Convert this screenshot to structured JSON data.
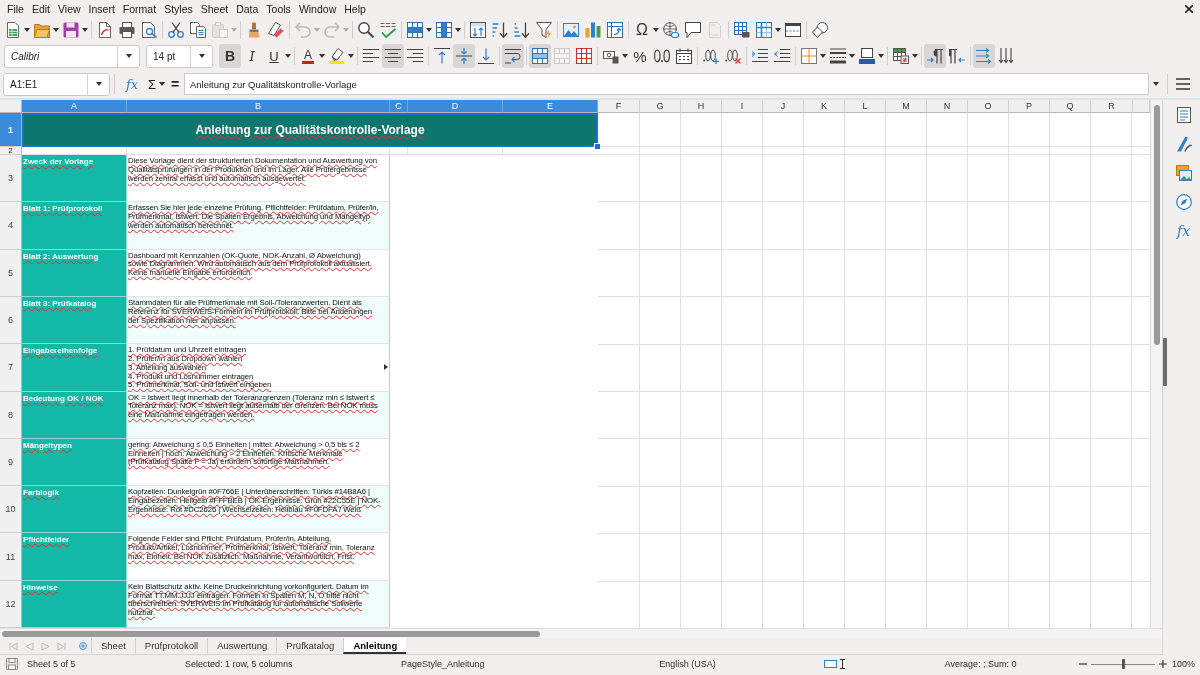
{
  "menu_bar": {
    "items": [
      "File",
      "Edit",
      "View",
      "Insert",
      "Format",
      "Styles",
      "Sheet",
      "Data",
      "Tools",
      "Window",
      "Help"
    ]
  },
  "standard_toolbar": {
    "groups": [
      [
        {
          "kind": "new",
          "dropdown": true,
          "disabled": false
        },
        {
          "kind": "open",
          "dropdown": true,
          "disabled": false
        },
        {
          "kind": "save",
          "dropdown": true,
          "disabled": false
        }
      ],
      [
        {
          "kind": "pdf",
          "dropdown": false,
          "disabled": false
        },
        {
          "kind": "print",
          "dropdown": false,
          "disabled": false
        },
        {
          "kind": "preview",
          "dropdown": false,
          "disabled": false
        }
      ],
      [
        {
          "kind": "cut",
          "dropdown": false,
          "disabled": false
        },
        {
          "kind": "copy",
          "dropdown": false,
          "disabled": false
        },
        {
          "kind": "paste",
          "dropdown": true,
          "disabled": true
        }
      ],
      [
        {
          "kind": "clone",
          "dropdown": false,
          "disabled": false
        },
        {
          "kind": "clear",
          "dropdown": false,
          "disabled": false
        }
      ],
      [
        {
          "kind": "undo",
          "dropdown": true,
          "disabled": true
        },
        {
          "kind": "redo",
          "dropdown": true,
          "disabled": true
        }
      ],
      [
        {
          "kind": "find",
          "dropdown": false,
          "disabled": false
        },
        {
          "kind": "spelling",
          "dropdown": false,
          "disabled": false
        }
      ],
      [
        {
          "kind": "rows",
          "dropdown": true,
          "disabled": false
        },
        {
          "kind": "columns",
          "dropdown": true,
          "disabled": false
        }
      ],
      [
        {
          "kind": "sort",
          "dropdown": false,
          "disabled": false
        },
        {
          "kind": "ascending",
          "dropdown": false,
          "disabled": false
        },
        {
          "kind": "descending",
          "dropdown": false,
          "disabled": false
        },
        {
          "kind": "filter",
          "dropdown": false,
          "disabled": false
        }
      ],
      [
        {
          "kind": "image",
          "dropdown": false,
          "disabled": false
        },
        {
          "kind": "chart",
          "dropdown": false,
          "disabled": false
        },
        {
          "kind": "pivot",
          "dropdown": false,
          "disabled": false
        }
      ],
      [
        {
          "kind": "special",
          "label": "Ω",
          "dropdown": true,
          "disabled": false
        },
        {
          "kind": "hyperlink",
          "dropdown": false,
          "disabled": false
        },
        {
          "kind": "comment",
          "dropdown": false,
          "disabled": false
        },
        {
          "kind": "header",
          "dropdown": false,
          "disabled": true
        }
      ],
      [
        {
          "kind": "printarea",
          "dropdown": false,
          "disabled": false
        },
        {
          "kind": "freeze",
          "dropdown": true,
          "disabled": false
        },
        {
          "kind": "split",
          "dropdown": false,
          "disabled": false
        }
      ],
      [
        {
          "kind": "shapes",
          "dropdown": false,
          "disabled": false
        }
      ]
    ]
  },
  "format_toolbar": {
    "font_name": "Calibri",
    "font_size": "14 pt",
    "groups": [
      [
        {
          "kind": "bold",
          "label": "B",
          "on": true,
          "dropdown": false,
          "disabled": false
        },
        {
          "kind": "italic",
          "label": "I",
          "on": false,
          "dropdown": false,
          "disabled": false
        },
        {
          "kind": "underline",
          "label": "U",
          "on": false,
          "dropdown": true,
          "disabled": false
        }
      ],
      [
        {
          "kind": "fontcolor",
          "label": "A",
          "on": false,
          "dropdown": true,
          "disabled": false
        },
        {
          "kind": "highlight",
          "on": false,
          "dropdown": true,
          "disabled": false
        }
      ],
      [
        {
          "kind": "left",
          "on": false,
          "dropdown": false,
          "disabled": false
        },
        {
          "kind": "center",
          "on": true,
          "dropdown": false,
          "disabled": false
        },
        {
          "kind": "right",
          "on": false,
          "dropdown": false,
          "disabled": false
        }
      ],
      [
        {
          "kind": "top",
          "on": false,
          "dropdown": false,
          "disabled": false
        },
        {
          "kind": "middle",
          "on": true,
          "dropdown": false,
          "disabled": false
        },
        {
          "kind": "bottom",
          "on": false,
          "dropdown": false,
          "disabled": false
        }
      ],
      [
        {
          "kind": "wrap",
          "on": true,
          "dropdown": false,
          "disabled": false
        }
      ],
      [
        {
          "kind": "mergecenter",
          "on": true,
          "dropdown": false,
          "disabled": false
        },
        {
          "kind": "merge",
          "on": false,
          "dropdown": false,
          "disabled": true
        },
        {
          "kind": "unmerge",
          "on": false,
          "dropdown": false,
          "disabled": false
        }
      ],
      [
        {
          "kind": "currency",
          "on": false,
          "dropdown": true,
          "disabled": false
        },
        {
          "kind": "percent",
          "label": "%",
          "on": false,
          "dropdown": false,
          "disabled": false
        },
        {
          "kind": "number",
          "on": false,
          "dropdown": false,
          "disabled": false
        },
        {
          "kind": "date",
          "on": false,
          "dropdown": false,
          "disabled": false
        }
      ],
      [
        {
          "kind": "adddecimal",
          "on": false,
          "dropdown": false,
          "disabled": false
        },
        {
          "kind": "deletedecimal",
          "on": false,
          "dropdown": false,
          "disabled": false
        }
      ],
      [
        {
          "kind": "indent",
          "on": false,
          "dropdown": false,
          "disabled": false
        },
        {
          "kind": "outdent",
          "on": false,
          "dropdown": false,
          "disabled": false
        }
      ],
      [
        {
          "kind": "borders",
          "on": false,
          "dropdown": true,
          "disabled": false
        },
        {
          "kind": "borderstyle",
          "on": false,
          "dropdown": true,
          "disabled": false
        },
        {
          "kind": "bordercolor",
          "on": false,
          "dropdown": true,
          "disabled": false
        }
      ],
      [
        {
          "kind": "conditional",
          "on": false,
          "dropdown": true,
          "disabled": false
        }
      ],
      [
        {
          "kind": "ltr",
          "on": true,
          "dropdown": false,
          "disabled": false
        },
        {
          "kind": "rtl",
          "on": false,
          "dropdown": false,
          "disabled": false
        }
      ],
      [
        {
          "kind": "textdir",
          "on": true,
          "dropdown": false,
          "disabled": false
        },
        {
          "kind": "vertical",
          "on": false,
          "dropdown": false,
          "disabled": false
        }
      ]
    ]
  },
  "formula_bar": {
    "name_box": "A1:E1",
    "wizard": "fx",
    "sum": "Σ",
    "equals": "=",
    "content": "Anleitung zur Qualitätskontrolle-Vorlage"
  },
  "sheet": {
    "columns": [
      {
        "label": "A",
        "selected": true
      },
      {
        "label": "B",
        "selected": true
      },
      {
        "label": "C",
        "selected": true
      },
      {
        "label": "D",
        "selected": true
      },
      {
        "label": "E",
        "selected": true
      },
      {
        "label": "F",
        "selected": false
      },
      {
        "label": "G",
        "selected": false
      },
      {
        "label": "H",
        "selected": false
      },
      {
        "label": "I",
        "selected": false
      },
      {
        "label": "J",
        "selected": false
      },
      {
        "label": "K",
        "selected": false
      },
      {
        "label": "L",
        "selected": false
      },
      {
        "label": "M",
        "selected": false
      },
      {
        "label": "N",
        "selected": false
      },
      {
        "label": "O",
        "selected": false
      },
      {
        "label": "P",
        "selected": false
      },
      {
        "label": "Q",
        "selected": false
      },
      {
        "label": "R",
        "selected": false
      }
    ],
    "rows": [
      {
        "label": "1",
        "selected": true
      },
      {
        "label": "2",
        "selected": false
      },
      {
        "label": "3",
        "selected": false
      },
      {
        "label": "4",
        "selected": false
      },
      {
        "label": "5",
        "selected": false
      },
      {
        "label": "6",
        "selected": false
      },
      {
        "label": "7",
        "selected": false
      },
      {
        "label": "8",
        "selected": false
      },
      {
        "label": "9",
        "selected": false
      },
      {
        "label": "10",
        "selected": false
      },
      {
        "label": "11",
        "selected": false
      },
      {
        "label": "12",
        "selected": false
      }
    ],
    "title": "Anleitung zur Qualitätskontrolle-Vorlage",
    "entries": [
      {
        "label": "Zweck der Vorlage",
        "text": "Diese Vorlage dient der strukturierten Dokumentation und Auswertung von Qualitätsprüfungen in der Produktion und im Lager. Alle Prüfergebnisse werden zentral erfasst und automatisch ausgewertet.",
        "overflow": false
      },
      {
        "label": "Blatt 1: Prüfprotokoll",
        "text": "Erfassen Sie hier jede einzelne Prüfung. Pflichtfelder: Prüfdatum, Prüfer/in, Prüfmerkmal, Istwert. Die Spalten Ergebnis, Abweichung und Mängeltyp werden automatisch berechnet.",
        "overflow": false
      },
      {
        "label": "Blatt 2: Auswertung",
        "text": "Dashboard mit Kennzahlen (OK-Quote, NOK-Anzahl, Ø Abweichung) sowie Diagrammen. Wird automatisch aus dem Prüfprotokoll aktualisiert. Keine manuelle Eingabe erforderlich.",
        "overflow": false
      },
      {
        "label": "Blatt 3: Prüfkatalog",
        "text": "Stammdaten für alle Prüfmerkmale mit Soll-/Toleranzwerten. Dient als Referenz für SVERWEIS-Formeln im Prüfprotokoll. Bitte bei Änderungen der Spezifikation hier anpassen.",
        "overflow": false
      },
      {
        "label": "Eingabereihenfolge",
        "text": "1. Prüfdatum und Uhrzeit eintragen\n2. Prüfer/in aus Dropdown wählen\n3. Abteilung auswählen\n4. Produkt und Losnummer eintragen\n5. Prüfmerkmal, Soll- und Istwert eingeben",
        "overflow": true
      },
      {
        "label": "Bedeutung OK / NOK",
        "text": "OK = Istwert liegt innerhalb der Toleranzgrenzen (Toleranz min ≤ Istwert ≤ Toleranz max). NOK = Istwert liegt außerhalb der Grenzen. Bei NOK muss eine Maßnahme eingetragen werden.",
        "overflow": false
      },
      {
        "label": "Mängeltypen",
        "text": "gering: Abweichung ≤ 0,5 Einheiten | mittel: Abweichung > 0,5 bis ≤ 2 Einheiten | hoch: Abweichung > 2 Einheiten. Kritische Merkmale (Prüfkatalog Spalte F = Ja) erfordern sofortige Maßnahmen.",
        "overflow": false
      },
      {
        "label": "Farblogik",
        "text": "Kopfzeilen: Dunkelgrün #0F766E | Unterüberschriften: Türkis #14B8A6 | Eingabezellen: Hellgelb #FFFBEB | OK-Ergebnisse: Grün #22C55E | NOK-Ergebnisse: Rot #DC2626 | Wechselzeilen: Hellblau #F0FDFA / Weiß",
        "overflow": false
      },
      {
        "label": "Pflichtfelder",
        "text": "Folgende Felder sind Pflicht: Prüfdatum, Prüfer/in, Abteilung, Produkt/Artikel, Losnummer, Prüfmerkmal, Istwert, Toleranz min, Toleranz max, Einheit. Bei NOK zusätzlich: Maßnahme, Verantwortlich, Frist.",
        "overflow": false
      },
      {
        "label": "Hinweise",
        "text": "Kein Blattschutz aktiv. Keine Druckeinrichtung vorkonfiguriert. Datum im Format TT.MM.JJJJ eintragen. Formeln in Spalten M, N, O bitte nicht überschreiben. SVERWEIS im Prüfkatalog für automatische Sollwerte nutzbar.",
        "overflow": false
      }
    ]
  },
  "sheet_tabs": {
    "navigation_disabled": true,
    "tabs": [
      {
        "label": "Sheet",
        "selected": false
      },
      {
        "label": "Prüfprotokoll",
        "selected": false
      },
      {
        "label": "Auswertung",
        "selected": false
      },
      {
        "label": "Prüfkatalog",
        "selected": false
      },
      {
        "label": "Anleitung",
        "selected": true
      }
    ]
  },
  "sidebar": {
    "buttons": [
      {
        "kind": "properties"
      },
      {
        "kind": "styles"
      },
      {
        "kind": "gallery"
      },
      {
        "kind": "navigator"
      },
      {
        "kind": "functions",
        "label": "fx"
      }
    ]
  },
  "status_bar": {
    "sheet": "Sheet 5 of 5",
    "selection": "Selected: 1 row, 5 columns",
    "page_style": "PageStyle_Anleitung",
    "language": "English (USA)",
    "summary": "Average: ; Sum: 0",
    "zoom": {
      "level": 0.5,
      "reading": "100%"
    }
  }
}
